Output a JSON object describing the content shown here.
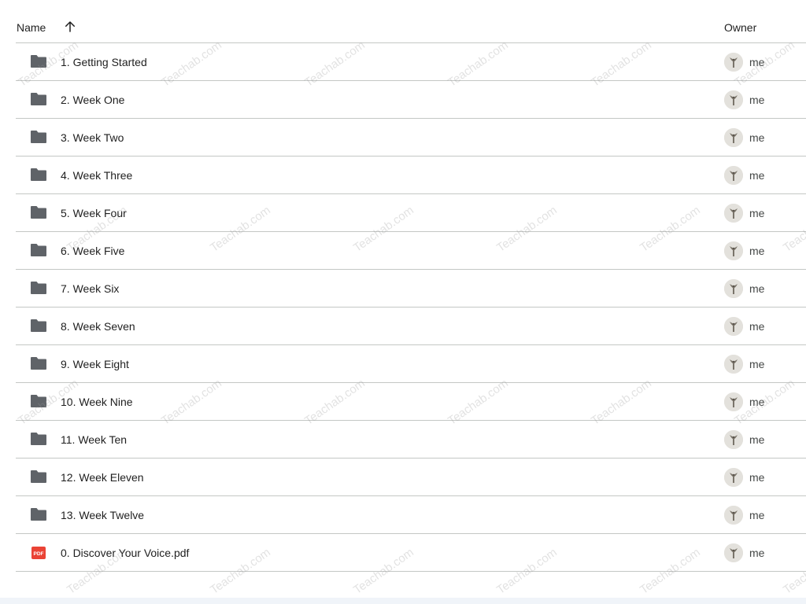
{
  "header": {
    "name_label": "Name",
    "sort_icon": "arrow-upward-icon",
    "owner_label": "Owner"
  },
  "files": [
    {
      "name": "1. Getting Started",
      "type": "folder",
      "owner": "me"
    },
    {
      "name": "2. Week One",
      "type": "folder",
      "owner": "me"
    },
    {
      "name": "3. Week Two",
      "type": "folder",
      "owner": "me"
    },
    {
      "name": "4. Week Three",
      "type": "folder",
      "owner": "me"
    },
    {
      "name": "5. Week Four",
      "type": "folder",
      "owner": "me"
    },
    {
      "name": "6. Week Five",
      "type": "folder",
      "owner": "me"
    },
    {
      "name": "7. Week Six",
      "type": "folder",
      "owner": "me"
    },
    {
      "name": "8. Week Seven",
      "type": "folder",
      "owner": "me"
    },
    {
      "name": "9. Week Eight",
      "type": "folder",
      "owner": "me"
    },
    {
      "name": "10. Week Nine",
      "type": "folder",
      "owner": "me"
    },
    {
      "name": "11. Week Ten",
      "type": "folder",
      "owner": "me"
    },
    {
      "name": "12. Week Eleven",
      "type": "folder",
      "owner": "me"
    },
    {
      "name": "13. Week Twelve",
      "type": "folder",
      "owner": "me"
    },
    {
      "name": "0. Discover Your Voice.pdf",
      "type": "pdf",
      "owner": "me"
    }
  ],
  "pdf_badge": "PDF",
  "watermark_text": "Teachab.com",
  "colors": {
    "folder_icon": "#5f6368",
    "pdf_icon": "#ea4335",
    "divider": "#c4c7c5",
    "text": "#1f1f1f"
  }
}
